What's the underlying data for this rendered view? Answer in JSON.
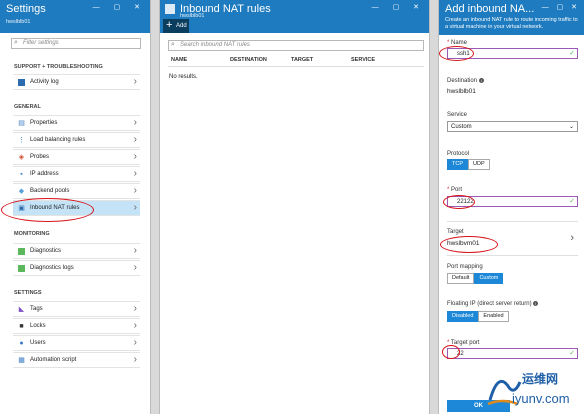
{
  "settings": {
    "title": "Settings",
    "subtitle": "hwslblb01",
    "header_icons": "— ▢ ✕",
    "filter_placeholder": "Filter settings",
    "groups": {
      "support": "SUPPORT + TROUBLESHOOTING",
      "general": "GENERAL",
      "monitoring": "MONITORING",
      "settings": "SETTINGS"
    },
    "items": [
      {
        "label": "Activity log"
      },
      {
        "label": "Properties"
      },
      {
        "label": "Load balancing rules"
      },
      {
        "label": "Probes"
      },
      {
        "label": "IP address"
      },
      {
        "label": "Backend pools"
      },
      {
        "label": "Inbound NAT rules"
      },
      {
        "label": "Diagnostics"
      },
      {
        "label": "Diagnostics logs"
      },
      {
        "label": "Tags"
      },
      {
        "label": "Locks"
      },
      {
        "label": "Users"
      },
      {
        "label": "Automation script"
      }
    ]
  },
  "nat_rules": {
    "title": "Inbound NAT rules",
    "subtitle": "hwslblb01",
    "header_icons": "— ▢ ✕",
    "add_label": "Add",
    "search_placeholder": "Search inbound NAT rules",
    "columns": [
      "NAME",
      "DESTINATION",
      "TARGET",
      "SERVICE"
    ],
    "empty_text": "No results."
  },
  "add_rule": {
    "title": "Add inbound NA...",
    "header_icons": "— ▢ ✕",
    "intro": "Create an inbound NAT rule to route incoming traffic to a virtual machine in your virtual network.",
    "name_label": "Name",
    "name_value": "ssh1",
    "destination_label": "Destination",
    "destination_value": "hwslblb01",
    "service_label": "Service",
    "service_value": "Custom",
    "protocol_label": "Protocol",
    "protocol_options": [
      "TCP",
      "UDP"
    ],
    "protocol_selected": "TCP",
    "port_label": "Port",
    "port_value": "22122",
    "target_label": "Target",
    "target_value": "hwslbvm01",
    "port_mapping_label": "Port mapping",
    "port_mapping_options": [
      "Default",
      "Custom"
    ],
    "port_mapping_selected": "Custom",
    "floating_ip_label": "Floating IP (direct server return)",
    "floating_ip_options": [
      "Disabled",
      "Enabled"
    ],
    "floating_ip_selected": "Disabled",
    "target_port_label": "Target port",
    "target_port_value": "22",
    "ok_label": "OK"
  },
  "watermark": {
    "line1": "运维网",
    "line2": "iyunv.com"
  },
  "colors": {
    "header_blue": "#1e7bbf",
    "accent_blue": "#1e88d8",
    "selected_row": "#c4e3f6",
    "annotation_red": "#d7141a"
  }
}
